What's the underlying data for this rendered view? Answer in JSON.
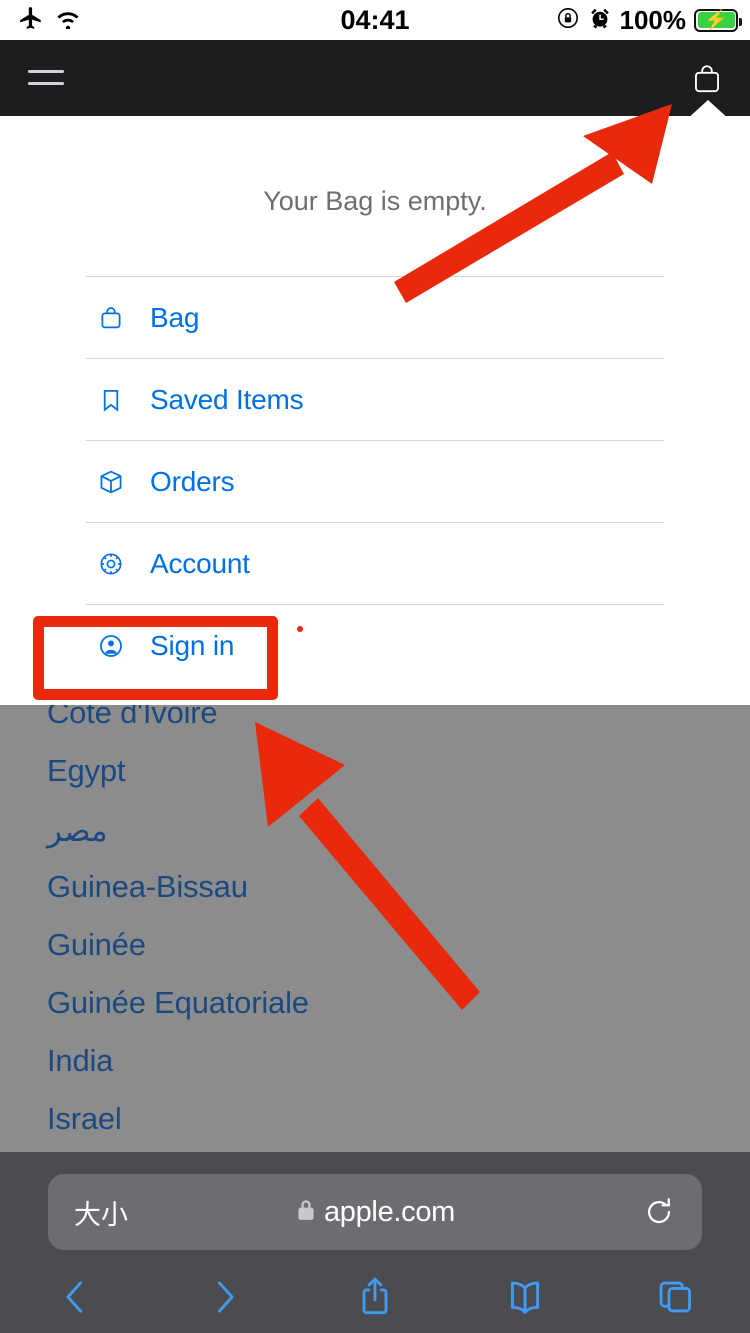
{
  "status_bar": {
    "airplane_icon": "airplane-icon",
    "wifi_icon": "wifi-icon",
    "time": "04:41",
    "rotation_lock_icon": "rotation-lock-icon",
    "alarm_icon": "alarm-clock-icon",
    "battery_percent": "100%",
    "battery_icon": "battery-charging-icon"
  },
  "nav": {
    "menu_icon": "hamburger-menu-icon",
    "logo_glyph": "",
    "bag_icon": "shopping-bag-icon"
  },
  "bag_panel": {
    "empty_message": "Your Bag is empty.",
    "items": [
      {
        "label": "Bag",
        "icon": "bag-icon"
      },
      {
        "label": "Saved Items",
        "icon": "bookmark-icon"
      },
      {
        "label": "Orders",
        "icon": "box-icon"
      },
      {
        "label": "Account",
        "icon": "gear-icon"
      },
      {
        "label": "Sign in",
        "icon": "person-circle-icon"
      }
    ]
  },
  "page_behind": {
    "countries": [
      "Côte d'Ivoire",
      "Egypt",
      "مصر",
      "Guinea-Bissau",
      "Guinée",
      "Guinée Equatoriale",
      "India",
      "Israel"
    ]
  },
  "annotations": {
    "highlight_color": "#e8290b",
    "highlight_target": "Sign in"
  },
  "safari": {
    "text_size_label": "大小",
    "lock_icon": "lock-icon",
    "url": "apple.com",
    "reload_icon": "reload-icon",
    "toolbar": [
      {
        "name": "back-button",
        "icon": "chevron-left-icon"
      },
      {
        "name": "forward-button",
        "icon": "chevron-right-icon"
      },
      {
        "name": "share-button",
        "icon": "share-icon"
      },
      {
        "name": "bookmarks-button",
        "icon": "book-icon"
      },
      {
        "name": "tabs-button",
        "icon": "tabs-icon"
      }
    ]
  },
  "colors": {
    "accent_blue": "#0071e3",
    "nav_dark": "#1d1d1f",
    "annotation_red": "#e8290b",
    "dim_gray": "#8c8c8c",
    "country_blue": "#1c4a80"
  }
}
